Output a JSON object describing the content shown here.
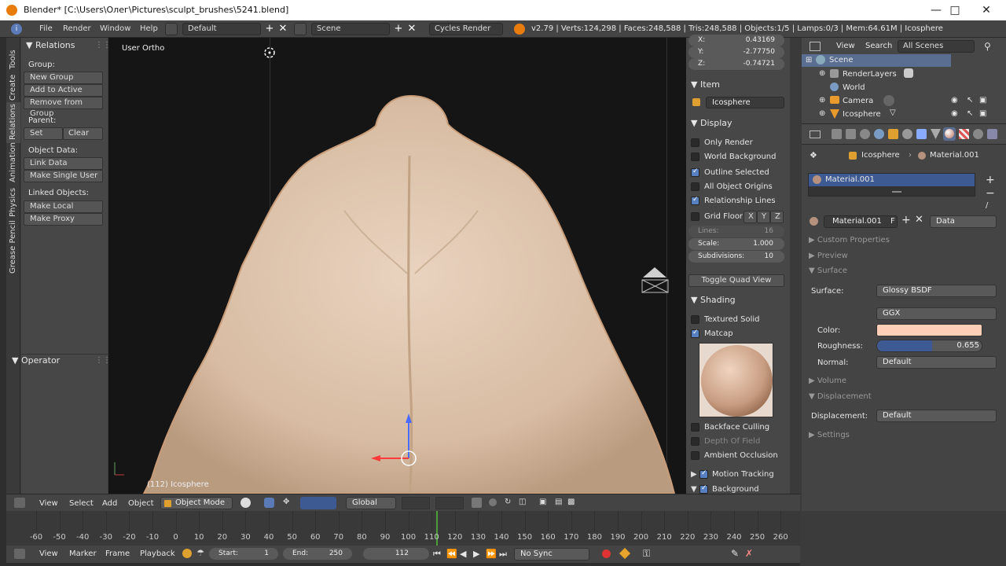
{
  "window": {
    "title": "Blender* [C:\\Users\\Олег\\Pictures\\sculpt_brushes\\5241.blend]"
  },
  "topbar": {
    "menus": [
      "File",
      "Render",
      "Window",
      "Help"
    ],
    "layout": "Default",
    "scene": "Scene",
    "engine": "Cycles Render",
    "stats": "v2.79 | Verts:124,298 | Faces:248,588 | Tris:248,588 | Objects:1/5 | Lamps:0/3 | Mem:64.61M | Icosphere"
  },
  "tabs": [
    "Tools",
    "Create",
    "Relations",
    "Animation",
    "Physics",
    "Grease Pencil"
  ],
  "toolshelf": {
    "title": "Relations",
    "group_label": "Group:",
    "new_group": "New Group",
    "add_to_active": "Add to Active",
    "remove_from_group": "Remove from Group",
    "parent_label": "Parent:",
    "set": "Set",
    "clear": "Clear",
    "object_data_label": "Object Data:",
    "link_data": "Link Data",
    "make_single_user": "Make Single User",
    "linked_objects_label": "Linked Objects:",
    "make_local": "Make Local",
    "make_proxy": "Make Proxy",
    "operator": "Operator"
  },
  "viewport": {
    "title": "User Ortho",
    "object_label": "(112) Icosphere"
  },
  "npanel": {
    "x_label": "X:",
    "x_value": "0.43169",
    "y_label": "Y:",
    "y_value": "-2.77750",
    "z_label": "Z:",
    "z_value": "-0.74721",
    "item_title": "Item",
    "item_name": "Icosphere",
    "display_title": "Display",
    "only_render": "Only Render",
    "world_background": "World Background",
    "outline_selected": "Outline Selected",
    "all_object_origins": "All Object Origins",
    "relationship_lines": "Relationship Lines",
    "grid_floor": "Grid Floor",
    "axis_x": "X",
    "axis_y": "Y",
    "axis_z": "Z",
    "lines_label": "Lines:",
    "lines_value": "16",
    "scale_label": "Scale:",
    "scale_value": "1.000",
    "subdivisions_label": "Subdivisions:",
    "subdivisions_value": "10",
    "toggle_quad_view": "Toggle Quad View",
    "shading_title": "Shading",
    "textured_solid": "Textured Solid",
    "matcap": "Matcap",
    "backface_culling": "Backface Culling",
    "depth_of_field": "Depth Of Field",
    "ambient_occlusion": "Ambient Occlusion",
    "motion_tracking": "Motion Tracking",
    "background_images": "Background Images"
  },
  "outliner": {
    "view": "View",
    "search": "Search",
    "filter": "All Scenes",
    "scene": "Scene",
    "render_layers": "RenderLayers",
    "world": "World",
    "camera": "Camera",
    "icosphere": "Icosphere"
  },
  "props": {
    "breadcrumb_object": "Icosphere",
    "breadcrumb_material": "Material.001",
    "slot": "Material.001",
    "material_name": "Material.001",
    "fake_user": "F",
    "link": "Data",
    "custom_properties": "Custom Properties",
    "preview": "Preview",
    "surface_section": "Surface",
    "surface_label": "Surface:",
    "surface_value": "Glossy BSDF",
    "distribution": "GGX",
    "color_label": "Color:",
    "color_value": "#fecfb6",
    "roughness_label": "Roughness:",
    "roughness_value": "0.655",
    "roughness_fraction": 0.655,
    "normal_label": "Normal:",
    "normal_value": "Default",
    "volume": "Volume",
    "displacement_section": "Displacement",
    "displacement_label": "Displacement:",
    "displacement_value": "Default",
    "settings": "Settings"
  },
  "vpheader": {
    "view": "View",
    "select": "Select",
    "add": "Add",
    "object": "Object",
    "mode": "Object Mode",
    "orientation": "Global"
  },
  "timeline": {
    "ticks": [
      "-60",
      "-50",
      "-40",
      "-30",
      "-20",
      "-10",
      "0",
      "10",
      "20",
      "30",
      "40",
      "50",
      "60",
      "70",
      "80",
      "90",
      "100",
      "110",
      "120",
      "130",
      "140",
      "150",
      "160",
      "170",
      "180",
      "190",
      "200",
      "210",
      "220",
      "230",
      "240",
      "250",
      "260"
    ],
    "current_frame_marker": 112,
    "view": "View",
    "marker": "Marker",
    "frame": "Frame",
    "playback": "Playback",
    "start_label": "Start:",
    "start_value": "1",
    "end_label": "End:",
    "end_value": "250",
    "current_frame": "112",
    "sync": "No Sync"
  }
}
